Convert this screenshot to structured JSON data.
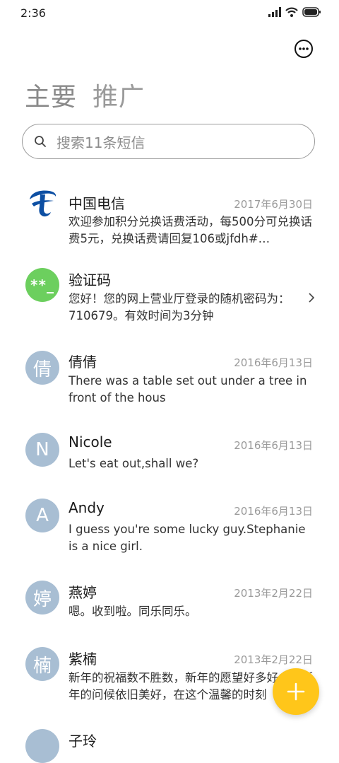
{
  "status_bar": {
    "time": "2:36"
  },
  "header": {
    "more_icon": "more-dots-icon",
    "tabs": [
      {
        "label": "主要"
      },
      {
        "label": "推广"
      }
    ]
  },
  "search": {
    "placeholder": "搜索11条短信",
    "icon": "search-icon"
  },
  "conversations": [
    {
      "name": "中国电信",
      "date": "2017年6月30日",
      "preview": "欢迎参加积分兑换话费活动，每500分可兑换话费5元，兑换话费请回复106或jfdh#…",
      "avatar_type": "telecom-logo"
    },
    {
      "name": "验证码",
      "date": "",
      "preview": "您好！您的网上营业厅登录的随机密码为：710679。有效时间为3分钟",
      "avatar_text": "**_",
      "has_chevron": true
    },
    {
      "name": "倩倩",
      "date": "2016年6月13日",
      "preview": "There was a table set out under a tree in front of the hous",
      "avatar_text": "倩"
    },
    {
      "name": "Nicole",
      "date": "2016年6月13日",
      "preview": "Let's eat out,shall we?",
      "avatar_text": "N"
    },
    {
      "name": "Andy",
      "date": "2016年6月13日",
      "preview": "I guess you're some lucky guy.Stephanie is a nice girl.",
      "avatar_text": "A"
    },
    {
      "name": "燕婷",
      "date": "2013年2月22日",
      "preview": "嗯。收到啦。同乐同乐。",
      "avatar_text": "婷"
    },
    {
      "name": "紫楠",
      "date": "2013年2月22日",
      "preview": "新年的祝福数不胜数，新年的愿望好多好多，新年的问候依旧美好，在这个温馨的时刻",
      "avatar_text": "楠"
    },
    {
      "name": "子玲",
      "date": "",
      "preview": "",
      "avatar_text": ""
    }
  ],
  "fab": {
    "icon": "plus-icon"
  },
  "colors": {
    "fab": "#ffc61a",
    "avatar": "#a8bed3",
    "avatar_green": "#6ccf5e",
    "telecom_blue": "#0d4fa3"
  }
}
